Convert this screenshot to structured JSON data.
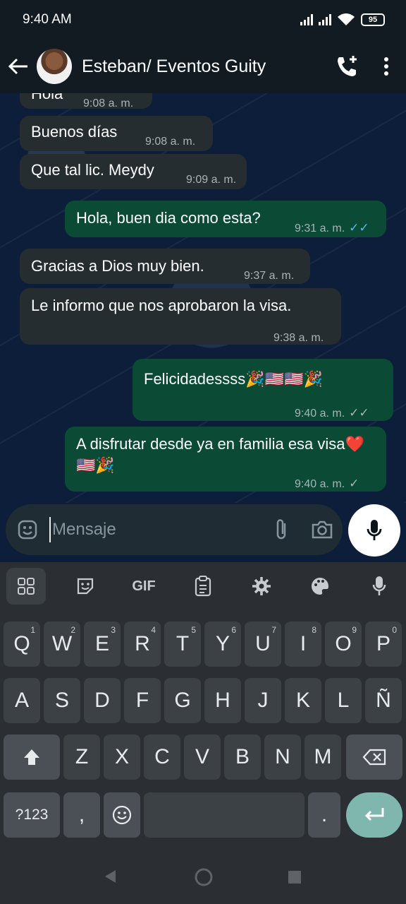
{
  "status_bar": {
    "time": "9:40 AM",
    "battery": "95"
  },
  "header": {
    "contact_name": "Esteban/ Eventos Guity"
  },
  "messages": [
    {
      "dir": "in",
      "text": "Hola",
      "time": "9:08 a. m."
    },
    {
      "dir": "in",
      "text": "Buenos días",
      "time": "9:08 a. m."
    },
    {
      "dir": "in",
      "text": "Que tal lic. Meydy",
      "time": "9:09 a. m."
    },
    {
      "dir": "out",
      "text": "Hola, buen dia como esta?",
      "time": "9:31 a. m.",
      "tick": "✓✓",
      "status": "read"
    },
    {
      "dir": "in",
      "text": "Gracias a Dios muy bien.",
      "time": "9:37 a. m."
    },
    {
      "dir": "in",
      "text": "Le informo que nos aprobaron la visa.",
      "time": "9:38 a. m."
    },
    {
      "dir": "out",
      "text": "Felicidadessss🎉🇺🇸🇺🇸🎉",
      "time": "9:40 a. m.",
      "tick": "✓✓",
      "status": "delivered"
    },
    {
      "dir": "out",
      "text": "A disfrutar desde ya en familia esa visa❤️🇺🇸🎉",
      "time": "9:40 a. m.",
      "tick": "✓",
      "status": "sent"
    }
  ],
  "composer": {
    "placeholder": "Mensaje"
  },
  "keyboard": {
    "toolbar": {
      "gif_label": "GIF"
    },
    "row1": [
      {
        "k": "Q",
        "n": "1"
      },
      {
        "k": "W",
        "n": "2"
      },
      {
        "k": "E",
        "n": "3"
      },
      {
        "k": "R",
        "n": "4"
      },
      {
        "k": "T",
        "n": "5"
      },
      {
        "k": "Y",
        "n": "6"
      },
      {
        "k": "U",
        "n": "7"
      },
      {
        "k": "I",
        "n": "8"
      },
      {
        "k": "O",
        "n": "9"
      },
      {
        "k": "P",
        "n": "0"
      }
    ],
    "row2": [
      "A",
      "S",
      "D",
      "F",
      "G",
      "H",
      "J",
      "K",
      "L",
      "Ñ"
    ],
    "row3": [
      "Z",
      "X",
      "C",
      "V",
      "B",
      "N",
      "M"
    ],
    "symbols_label": "?123",
    "comma": ",",
    "period": "."
  },
  "colors": {
    "incoming_bubble": "#262d31",
    "outgoing_bubble": "#0b4a35",
    "read_tick": "#53bdeb",
    "enter_key": "#7fb7ae"
  }
}
